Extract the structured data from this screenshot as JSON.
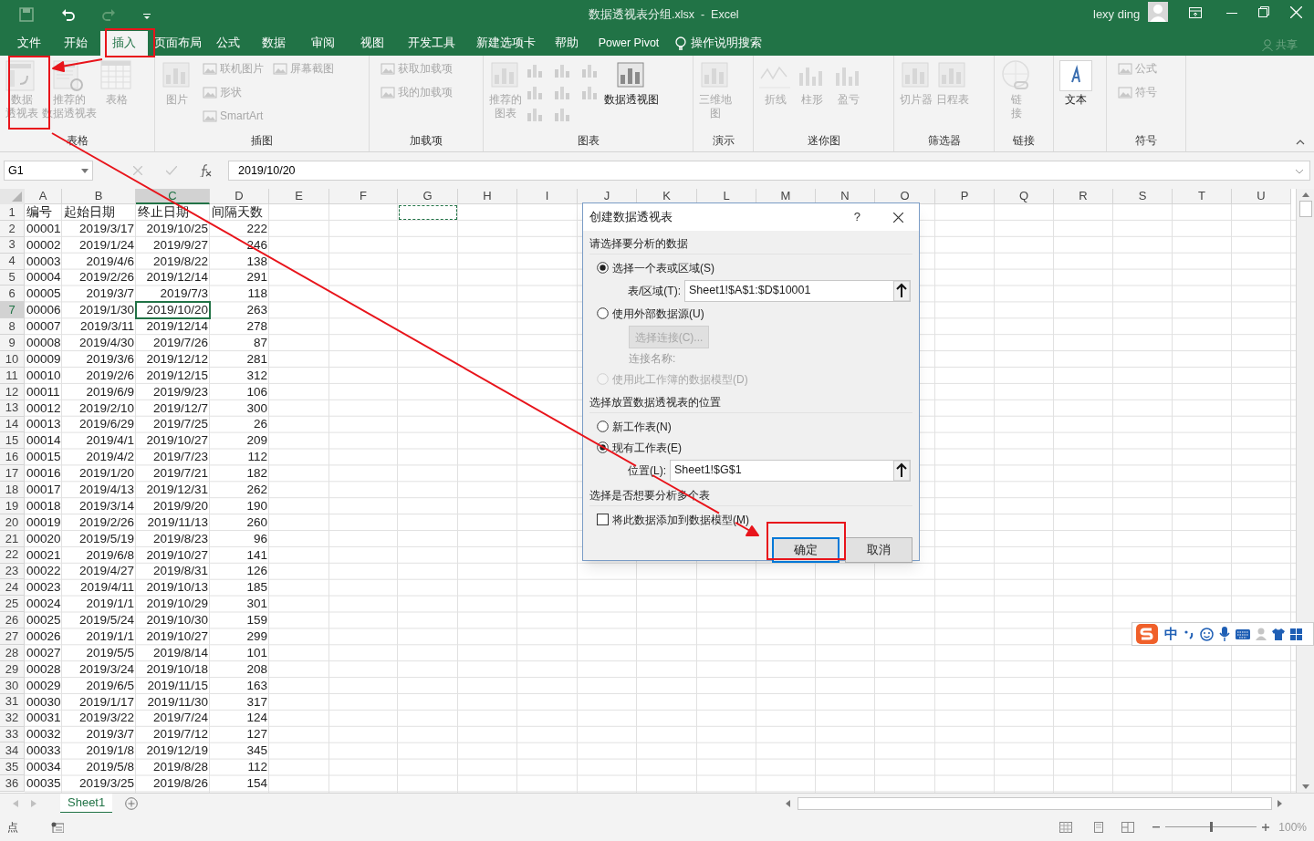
{
  "window": {
    "title": "数据透视表分组.xlsx  -  Excel",
    "user": "lexy ding"
  },
  "menu_tabs": [
    {
      "label": "文件",
      "selected": false
    },
    {
      "label": "开始",
      "selected": false
    },
    {
      "label": "插入",
      "selected": true
    },
    {
      "label": "页面布局",
      "selected": false
    },
    {
      "label": "公式",
      "selected": false
    },
    {
      "label": "数据",
      "selected": false
    },
    {
      "label": "审阅",
      "selected": false
    },
    {
      "label": "视图",
      "selected": false
    },
    {
      "label": "开发工具",
      "selected": false
    },
    {
      "label": "新建选项卡",
      "selected": false
    },
    {
      "label": "帮助",
      "selected": false
    },
    {
      "label": "Power Pivot",
      "selected": false
    }
  ],
  "tell_me": "操作说明搜索",
  "share": "共享",
  "ribbon_groups": [
    {
      "label": "表格",
      "items": [
        {
          "kind": "large",
          "lines": [
            "数据",
            "透视表"
          ],
          "disabled": true
        },
        {
          "kind": "large",
          "lines": [
            "推荐的",
            "数据透视表"
          ],
          "disabled": true
        },
        {
          "kind": "large",
          "lines": [
            "表格"
          ],
          "disabled": true
        }
      ]
    },
    {
      "label": "插图",
      "items": [
        {
          "kind": "large",
          "lines": [
            "图片"
          ],
          "disabled": true
        },
        {
          "kind": "small",
          "label": "联机图片",
          "disabled": true
        },
        {
          "kind": "small",
          "label": "形状",
          "disabled": true
        },
        {
          "kind": "small",
          "label": "SmartArt",
          "disabled": true
        },
        {
          "kind": "small",
          "label": "屏幕截图",
          "disabled": true
        }
      ]
    },
    {
      "label": "加载项",
      "items": [
        {
          "kind": "small",
          "label": "获取加载项",
          "disabled": true
        },
        {
          "kind": "small",
          "label": "我的加载项",
          "disabled": true
        }
      ]
    },
    {
      "label": "图表",
      "items": [
        {
          "kind": "large",
          "lines": [
            "推荐的",
            "图表"
          ],
          "disabled": true
        },
        {
          "kind": "icons",
          "disabled": true
        },
        {
          "kind": "large",
          "lines": [
            "数据透视图"
          ],
          "disabled": false
        }
      ]
    },
    {
      "label": "演示",
      "items": [
        {
          "kind": "large",
          "lines": [
            "三维地",
            "图"
          ],
          "disabled": true
        }
      ]
    },
    {
      "label": "迷你图",
      "items": [
        {
          "kind": "large",
          "lines": [
            "折线"
          ],
          "disabled": true
        },
        {
          "kind": "large",
          "lines": [
            "柱形"
          ],
          "disabled": true
        },
        {
          "kind": "large",
          "lines": [
            "盈亏"
          ],
          "disabled": true
        }
      ]
    },
    {
      "label": "筛选器",
      "items": [
        {
          "kind": "large",
          "lines": [
            "切片器"
          ],
          "disabled": true
        },
        {
          "kind": "large",
          "lines": [
            "日程表"
          ],
          "disabled": true
        }
      ]
    },
    {
      "label": "链接",
      "items": [
        {
          "kind": "large",
          "lines": [
            "链",
            "接"
          ],
          "disabled": true
        }
      ]
    },
    {
      "items": [
        {
          "kind": "large",
          "lines": [
            "文本"
          ],
          "disabled": false
        }
      ]
    },
    {
      "label": "符号",
      "items": [
        {
          "kind": "small",
          "label": "公式",
          "disabled": true
        },
        {
          "kind": "small",
          "label": "符号",
          "disabled": true
        }
      ]
    }
  ],
  "name_box": "G1",
  "formula": "2019/10/20",
  "columns": [
    {
      "label": "A",
      "selected": false
    },
    {
      "label": "B",
      "selected": false
    },
    {
      "label": "C",
      "selected": true
    },
    {
      "label": "D",
      "selected": false
    },
    {
      "label": "E",
      "selected": false
    },
    {
      "label": "F",
      "selected": false
    },
    {
      "label": "G",
      "selected": false
    },
    {
      "label": "H",
      "selected": false
    },
    {
      "label": "I",
      "selected": false
    },
    {
      "label": "J",
      "selected": false
    },
    {
      "label": "K",
      "selected": false
    },
    {
      "label": "L",
      "selected": false
    },
    {
      "label": "M",
      "selected": false
    },
    {
      "label": "N",
      "selected": false
    },
    {
      "label": "O",
      "selected": false
    },
    {
      "label": "P",
      "selected": false
    },
    {
      "label": "Q",
      "selected": false
    },
    {
      "label": "R",
      "selected": false
    },
    {
      "label": "S",
      "selected": false
    },
    {
      "label": "T",
      "selected": false
    },
    {
      "label": "U",
      "selected": false
    }
  ],
  "rows": [
    {
      "number": "1",
      "selected": false,
      "cells": [
        "编号",
        "起始日期",
        "终止日期",
        "间隔天数"
      ]
    },
    {
      "number": "2",
      "selected": false,
      "cells": [
        "00001",
        "2019/3/17",
        "2019/10/25",
        "222"
      ]
    },
    {
      "number": "3",
      "selected": false,
      "cells": [
        "00002",
        "2019/1/24",
        "2019/9/27",
        "246"
      ]
    },
    {
      "number": "4",
      "selected": false,
      "cells": [
        "00003",
        "2019/4/6",
        "2019/8/22",
        "138"
      ]
    },
    {
      "number": "5",
      "selected": false,
      "cells": [
        "00004",
        "2019/2/26",
        "2019/12/14",
        "291"
      ]
    },
    {
      "number": "6",
      "selected": false,
      "cells": [
        "00005",
        "2019/3/7",
        "2019/7/3",
        "118"
      ]
    },
    {
      "number": "7",
      "selected": true,
      "cells": [
        "00006",
        "2019/1/30",
        "2019/10/20",
        "263"
      ]
    },
    {
      "number": "8",
      "selected": false,
      "cells": [
        "00007",
        "2019/3/11",
        "2019/12/14",
        "278"
      ]
    },
    {
      "number": "9",
      "selected": false,
      "cells": [
        "00008",
        "2019/4/30",
        "2019/7/26",
        "87"
      ]
    },
    {
      "number": "10",
      "selected": false,
      "cells": [
        "00009",
        "2019/3/6",
        "2019/12/12",
        "281"
      ]
    },
    {
      "number": "11",
      "selected": false,
      "cells": [
        "00010",
        "2019/2/6",
        "2019/12/15",
        "312"
      ]
    },
    {
      "number": "12",
      "selected": false,
      "cells": [
        "00011",
        "2019/6/9",
        "2019/9/23",
        "106"
      ]
    },
    {
      "number": "13",
      "selected": false,
      "cells": [
        "00012",
        "2019/2/10",
        "2019/12/7",
        "300"
      ]
    },
    {
      "number": "14",
      "selected": false,
      "cells": [
        "00013",
        "2019/6/29",
        "2019/7/25",
        "26"
      ]
    },
    {
      "number": "15",
      "selected": false,
      "cells": [
        "00014",
        "2019/4/1",
        "2019/10/27",
        "209"
      ]
    },
    {
      "number": "16",
      "selected": false,
      "cells": [
        "00015",
        "2019/4/2",
        "2019/7/23",
        "112"
      ]
    },
    {
      "number": "17",
      "selected": false,
      "cells": [
        "00016",
        "2019/1/20",
        "2019/7/21",
        "182"
      ]
    },
    {
      "number": "18",
      "selected": false,
      "cells": [
        "00017",
        "2019/4/13",
        "2019/12/31",
        "262"
      ]
    },
    {
      "number": "19",
      "selected": false,
      "cells": [
        "00018",
        "2019/3/14",
        "2019/9/20",
        "190"
      ]
    },
    {
      "number": "20",
      "selected": false,
      "cells": [
        "00019",
        "2019/2/26",
        "2019/11/13",
        "260"
      ]
    },
    {
      "number": "21",
      "selected": false,
      "cells": [
        "00020",
        "2019/5/19",
        "2019/8/23",
        "96"
      ]
    },
    {
      "number": "22",
      "selected": false,
      "cells": [
        "00021",
        "2019/6/8",
        "2019/10/27",
        "141"
      ]
    },
    {
      "number": "23",
      "selected": false,
      "cells": [
        "00022",
        "2019/4/27",
        "2019/8/31",
        "126"
      ]
    },
    {
      "number": "24",
      "selected": false,
      "cells": [
        "00023",
        "2019/4/11",
        "2019/10/13",
        "185"
      ]
    },
    {
      "number": "25",
      "selected": false,
      "cells": [
        "00024",
        "2019/1/1",
        "2019/10/29",
        "301"
      ]
    },
    {
      "number": "26",
      "selected": false,
      "cells": [
        "00025",
        "2019/5/24",
        "2019/10/30",
        "159"
      ]
    },
    {
      "number": "27",
      "selected": false,
      "cells": [
        "00026",
        "2019/1/1",
        "2019/10/27",
        "299"
      ]
    },
    {
      "number": "28",
      "selected": false,
      "cells": [
        "00027",
        "2019/5/5",
        "2019/8/14",
        "101"
      ]
    },
    {
      "number": "29",
      "selected": false,
      "cells": [
        "00028",
        "2019/3/24",
        "2019/10/18",
        "208"
      ]
    },
    {
      "number": "30",
      "selected": false,
      "cells": [
        "00029",
        "2019/6/5",
        "2019/11/15",
        "163"
      ]
    },
    {
      "number": "31",
      "selected": false,
      "cells": [
        "00030",
        "2019/1/17",
        "2019/11/30",
        "317"
      ]
    },
    {
      "number": "32",
      "selected": false,
      "cells": [
        "00031",
        "2019/3/22",
        "2019/7/24",
        "124"
      ]
    },
    {
      "number": "33",
      "selected": false,
      "cells": [
        "00032",
        "2019/3/7",
        "2019/7/12",
        "127"
      ]
    },
    {
      "number": "34",
      "selected": false,
      "cells": [
        "00033",
        "2019/1/8",
        "2019/12/19",
        "345"
      ]
    },
    {
      "number": "35",
      "selected": false,
      "cells": [
        "00034",
        "2019/5/8",
        "2019/8/28",
        "112"
      ]
    },
    {
      "number": "36",
      "selected": false,
      "cells": [
        "00035",
        "2019/3/25",
        "2019/8/26",
        "154"
      ]
    }
  ],
  "dialog": {
    "title": "创建数据透视表",
    "help": "?",
    "items": [
      {
        "kind": "heading",
        "text": "请选择要分析的数据"
      },
      {
        "kind": "radio",
        "label": "选择一个表或区域(S)",
        "selected": true,
        "disabled": false
      },
      {
        "kind": "field",
        "label": "表/区域(T):",
        "value": "Sheet1!$A$1:$D$10001"
      },
      {
        "kind": "radio",
        "label": "使用外部数据源(U)",
        "selected": false,
        "disabled": false
      },
      {
        "kind": "button",
        "label": "选择连接(C)...",
        "disabled": true
      },
      {
        "kind": "note",
        "text": "连接名称:"
      },
      {
        "kind": "radio",
        "label": "使用此工作簿的数据模型(D)",
        "selected": false,
        "disabled": true
      },
      {
        "kind": "heading",
        "text": "选择放置数据透视表的位置"
      },
      {
        "kind": "radio",
        "label": "新工作表(N)",
        "selected": false,
        "disabled": false
      },
      {
        "kind": "radio",
        "label": "现有工作表(E)",
        "selected": true,
        "disabled": false
      },
      {
        "kind": "field",
        "label": "位置(L):",
        "value": "Sheet1!$G$1"
      },
      {
        "kind": "heading",
        "text": "选择是否想要分析多个表"
      },
      {
        "kind": "checkbox",
        "label": "将此数据添加到数据模型(M)",
        "checked": false
      }
    ],
    "ok": "确定",
    "cancel": "取消"
  },
  "sheet_tabs": [
    {
      "label": "Sheet1",
      "selected": true
    }
  ],
  "status": "点",
  "ime": "中",
  "zoom": {
    "level": 0.5,
    "label": "100%"
  }
}
